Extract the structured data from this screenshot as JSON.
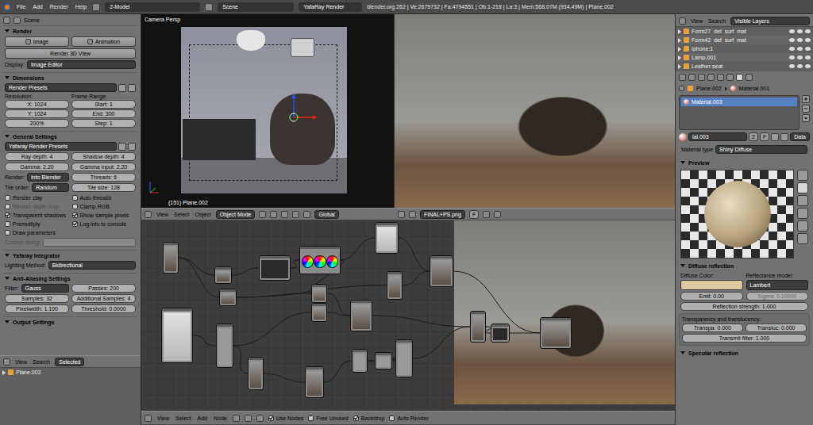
{
  "topbar": {
    "menus": [
      "File",
      "Add",
      "Render",
      "Help"
    ],
    "layout": "2-Model",
    "scene": "Scene",
    "engine": "YafaRay Render",
    "stats": "blender.org 262 | Ve:2679732 | Fa:4794551 | Ob:1-218 | La:3 | Mem:568.07M (934.49M) | Plane.002"
  },
  "properties_left": {
    "context": "Scene",
    "sections": [
      {
        "title": "Render",
        "expanded": true,
        "rows": [
          {
            "kind": "buttons",
            "items": [
              "Image",
              "Animation"
            ]
          },
          {
            "kind": "button",
            "text": "Render 3D View"
          },
          {
            "kind": "select",
            "label": "Display:",
            "value": "Image Editor"
          }
        ]
      },
      {
        "title": "Dimensions",
        "expanded": true,
        "rows": [
          {
            "kind": "preset",
            "value": "Render Presets"
          },
          {
            "kind": "columns",
            "cols": [
              {
                "label": "Resolution:",
                "fields": [
                  "X: 1024",
                  "Y: 1024",
                  "200%"
                ]
              },
              {
                "label": "Frame Range:",
                "fields": [
                  "Start: 1",
                  "End: 300",
                  "Step: 1"
                ]
              }
            ]
          }
        ]
      },
      {
        "title": "General Settings",
        "expanded": true,
        "rows": [
          {
            "kind": "preset",
            "value": "Yafaray Render Presets"
          },
          {
            "kind": "pair",
            "items": [
              {
                "kind": "number",
                "text": "Ray depth: 4"
              },
              {
                "kind": "number",
                "text": "Shadow depth: 4"
              }
            ]
          },
          {
            "kind": "pair",
            "items": [
              {
                "kind": "number",
                "text": "Gamma: 2.20"
              },
              {
                "kind": "number",
                "text": "Gamma input: 2.20"
              }
            ]
          },
          {
            "kind": "pair",
            "items": [
              {
                "kind": "select",
                "label": "Render:",
                "value": "Into Blender"
              },
              {
                "kind": "number",
                "text": "Threads: 6"
              }
            ]
          },
          {
            "kind": "pair",
            "items": [
              {
                "kind": "select",
                "label": "Tile order:",
                "value": "Random"
              },
              {
                "kind": "number",
                "text": "Tile size: 128"
              }
            ]
          },
          {
            "kind": "checks",
            "items": [
              {
                "label": "Render clay",
                "checked": false,
                "disabled": false
              },
              {
                "label": "Auto threads",
                "checked": false,
                "disabled": false
              },
              {
                "label": "Render depth map",
                "checked": false,
                "disabled": true
              },
              {
                "label": "Clamp RGB",
                "checked": false,
                "disabled": false
              },
              {
                "label": "Transparent shadows",
                "checked": true,
                "disabled": false
              },
              {
                "label": "Show sample pixels",
                "checked": true,
                "disabled": false
              },
              {
                "label": "Premultiply",
                "checked": false,
                "disabled": false
              },
              {
                "label": "Log info to console",
                "checked": true,
                "disabled": false
              },
              {
                "label": "Draw parameters",
                "checked": false,
                "disabled": false
              }
            ]
          },
          {
            "kind": "text",
            "label": "Custom string:",
            "disabled": true
          }
        ]
      },
      {
        "title": "Yafaray Integrator",
        "expanded": true,
        "rows": [
          {
            "kind": "select",
            "label": "Lighting Method:",
            "value": "Bidirectional"
          }
        ]
      },
      {
        "title": "Anti-Aliasing Settings",
        "expanded": true,
        "rows": [
          {
            "kind": "pair",
            "items": [
              {
                "kind": "select",
                "label": "Filter:",
                "value": "Gauss"
              },
              {
                "kind": "number",
                "text": "Passes: 200"
              }
            ]
          },
          {
            "kind": "pair",
            "items": [
              {
                "kind": "number",
                "text": "Samples: 32"
              },
              {
                "kind": "number",
                "text": "Additional Samples: 4"
              }
            ]
          },
          {
            "kind": "pair",
            "items": [
              {
                "kind": "number",
                "text": "Pixelwidth: 1.100"
              },
              {
                "kind": "number",
                "text": "Threshold: 0.0000"
              }
            ]
          }
        ]
      },
      {
        "title": "Output Settings",
        "expanded": true,
        "rows": []
      }
    ]
  },
  "outliner_left": {
    "menus": [
      "View",
      "Search"
    ],
    "filter": "Selected",
    "items": [
      {
        "name": "Plane.002",
        "selected": false
      }
    ]
  },
  "viewport": {
    "label": "Camera Persp",
    "object_label": "(151) Plane.002"
  },
  "viewport_header": {
    "menus": [
      "View",
      "Select",
      "Object"
    ],
    "mode": "Object Mode",
    "orientation": "Global"
  },
  "image_header": {
    "image": "FINAL+PS.png",
    "fake": "F"
  },
  "node_footer": {
    "menus": [
      "View",
      "Select",
      "Add",
      "Node"
    ],
    "toggles": [
      {
        "label": "Use Nodes",
        "checked": true
      },
      {
        "label": "Free Unused",
        "checked": false
      },
      {
        "label": "Backdrop",
        "checked": true
      },
      {
        "label": "Auto Render",
        "checked": false
      }
    ]
  },
  "outliner_right": {
    "menus": [
      "View",
      "Search"
    ],
    "filter": "Visible Layers",
    "items": [
      {
        "name": "Form27_def_surf_mat"
      },
      {
        "name": "Form42_def_surf_mat"
      },
      {
        "name": "Iphone:1"
      },
      {
        "name": "Lamp.001"
      },
      {
        "name": "Leather-seat"
      }
    ]
  },
  "material": {
    "object": "Plane.002",
    "material": "Material.001",
    "slots": [
      {
        "name": "Material.003",
        "selected": true
      }
    ],
    "datablock": {
      "name": "ial.003",
      "users": "2",
      "fake": "F",
      "link": "Data"
    },
    "type_label": "Material type",
    "type": "Shiny Diffuse",
    "preview": {
      "title": "Preview",
      "expanded": true
    },
    "diffuse": {
      "title": "Diffuse reflection",
      "expanded": true,
      "color_label": "Diffuse Color:",
      "color": "#dccaa3",
      "model_label": "Reflectance model:",
      "model": "Lambert",
      "emit": "Emit: 0.00",
      "sigma": "Sigma: 0.10000",
      "sigma_disabled": true,
      "strength": "Reflection strength: 1.000"
    },
    "transparency": {
      "title": "Transparency and translucency:",
      "transparency": "Transpa: 0.000",
      "translucency": "Transluc: 0.000",
      "filter": "Transmit filter: 1.000"
    },
    "specular": {
      "title": "Specular reflection",
      "expanded": true
    }
  }
}
